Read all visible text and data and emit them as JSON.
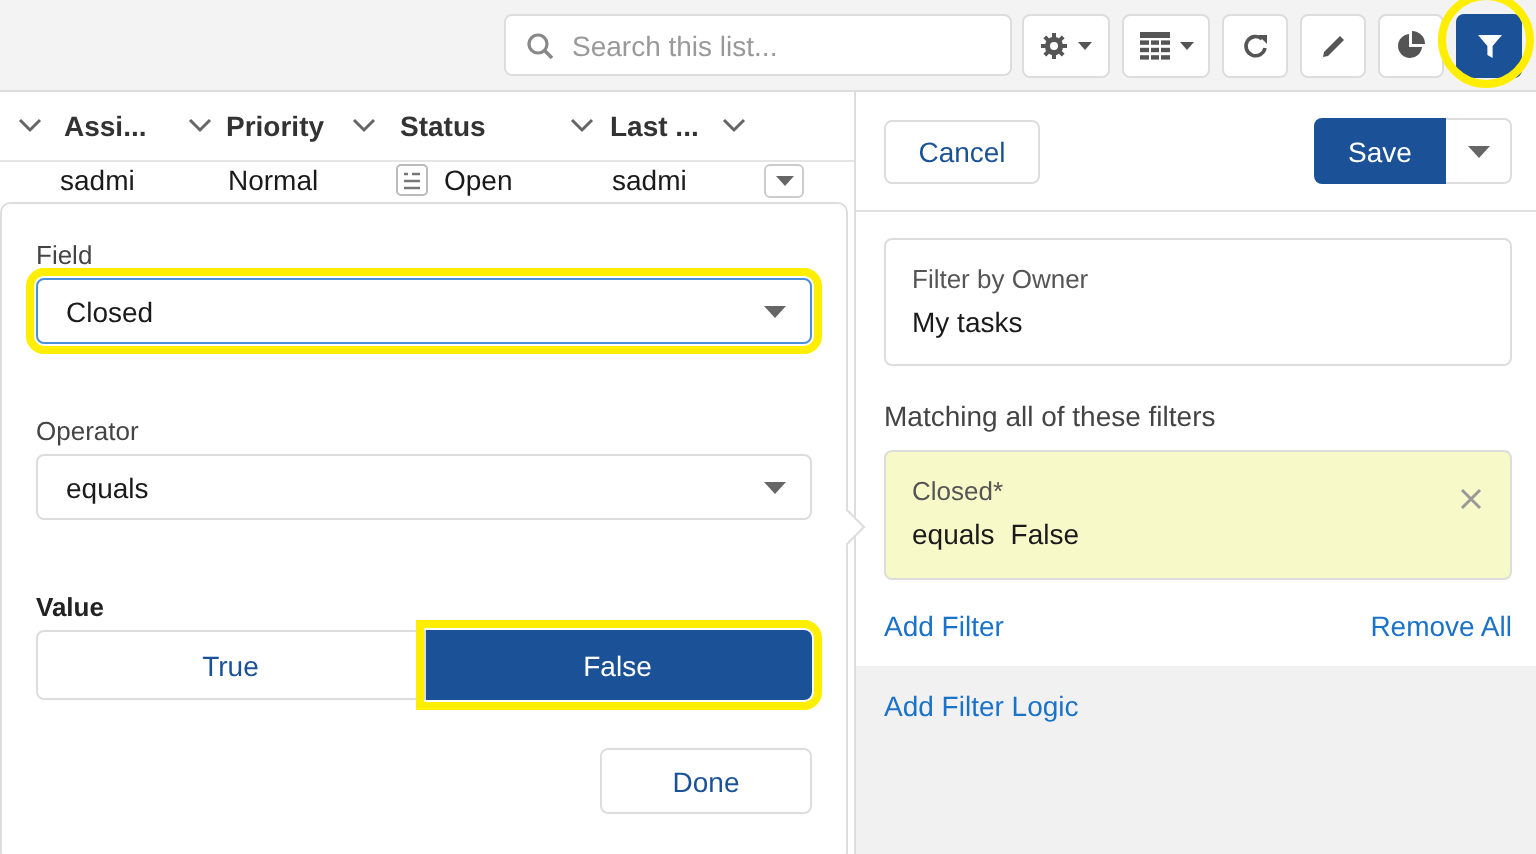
{
  "toolbar": {
    "search": {
      "placeholder": "Search this list..."
    },
    "buttons": [
      {
        "kind": "settings",
        "menu": true,
        "selected": false,
        "highlighted": false
      },
      {
        "kind": "table",
        "menu": true,
        "selected": false,
        "highlighted": false
      },
      {
        "kind": "refresh",
        "menu": false,
        "selected": false,
        "highlighted": false
      },
      {
        "kind": "edit",
        "menu": false,
        "selected": false,
        "highlighted": false
      },
      {
        "kind": "chart",
        "menu": false,
        "selected": false,
        "highlighted": false
      },
      {
        "kind": "filter",
        "menu": false,
        "selected": true,
        "highlighted": true
      }
    ]
  },
  "table": {
    "columns": [
      {
        "label": "Assi..."
      },
      {
        "label": "Priority"
      },
      {
        "label": "Status"
      },
      {
        "label": "Last ..."
      }
    ],
    "rows": [
      {
        "cells": [
          "sadmi",
          "Normal",
          "Open",
          "sadmi"
        ]
      }
    ]
  },
  "popover": {
    "field": {
      "label": "Field",
      "value": "Closed",
      "highlighted": true
    },
    "operator": {
      "label": "Operator",
      "value": "equals"
    },
    "value": {
      "label": "Value",
      "options": [
        {
          "label": "True",
          "selected": false,
          "highlighted": false
        },
        {
          "label": "False",
          "selected": true,
          "highlighted": true
        }
      ]
    },
    "done": "Done"
  },
  "panel": {
    "cancel": "Cancel",
    "save": "Save",
    "owner_filter": {
      "label": "Filter by Owner",
      "value": "My tasks"
    },
    "filters_heading": "Matching all of these filters",
    "filters": [
      {
        "field": "Closed*",
        "operator": "equals",
        "value": "False"
      }
    ],
    "add_filter": "Add Filter",
    "remove_all": "Remove All",
    "add_filter_logic": "Add Filter Logic"
  }
}
